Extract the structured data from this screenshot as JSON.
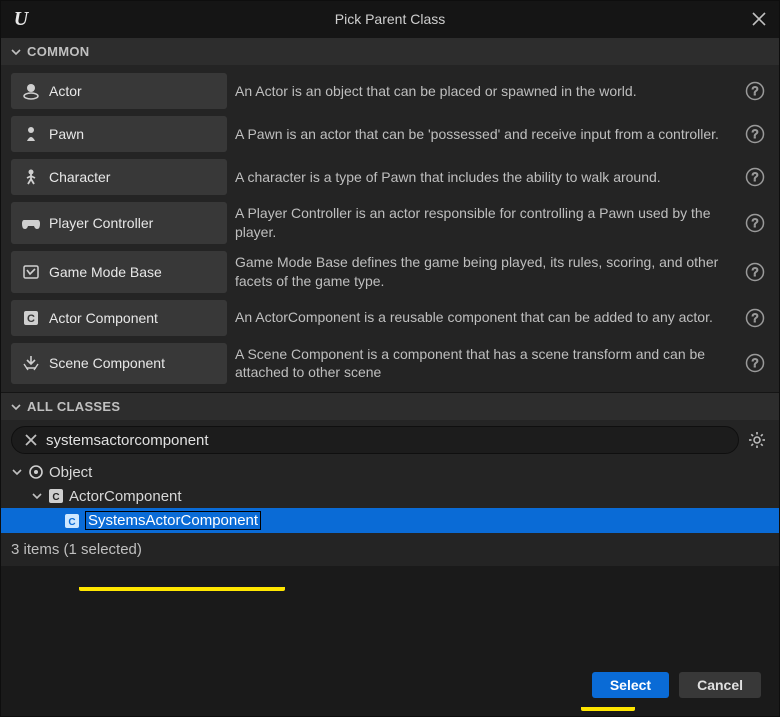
{
  "titlebar": {
    "title": "Pick Parent Class"
  },
  "sections": {
    "common": "COMMON",
    "all": "ALL CLASSES"
  },
  "common": [
    {
      "name": "Actor",
      "icon": "actor-icon",
      "desc": "An Actor is an object that can be placed or spawned in the world."
    },
    {
      "name": "Pawn",
      "icon": "pawn-icon",
      "desc": "A Pawn is an actor that can be 'possessed' and receive input from a controller."
    },
    {
      "name": "Character",
      "icon": "character-icon",
      "desc": "A character is a type of Pawn that includes the ability to walk around."
    },
    {
      "name": "Player Controller",
      "icon": "controller-icon",
      "desc": "A Player Controller is an actor responsible for controlling a Pawn used by the player."
    },
    {
      "name": "Game Mode Base",
      "icon": "gamemode-icon",
      "desc": "Game Mode Base defines the game being played, its rules, scoring, and other facets of the game type."
    },
    {
      "name": "Actor Component",
      "icon": "component-icon",
      "desc": "An ActorComponent is a reusable component that can be added to any actor."
    },
    {
      "name": "Scene Component",
      "icon": "scene-icon",
      "desc": "A Scene Component is a component that has a scene transform and can be attached to other scene"
    }
  ],
  "search": {
    "value": "systemsactorcomponent"
  },
  "tree": {
    "items": [
      {
        "label": "Object",
        "indent": 0,
        "icon": "object-icon",
        "expanded": true,
        "selected": false
      },
      {
        "label": "ActorComponent",
        "indent": 1,
        "icon": "component-icon",
        "expanded": true,
        "selected": false
      },
      {
        "label": "SystemsActorComponent",
        "indent": 2,
        "icon": "component-icon",
        "expanded": false,
        "selected": true
      }
    ]
  },
  "status": "3 items (1 selected)",
  "footer": {
    "select": "Select",
    "cancel": "Cancel"
  }
}
